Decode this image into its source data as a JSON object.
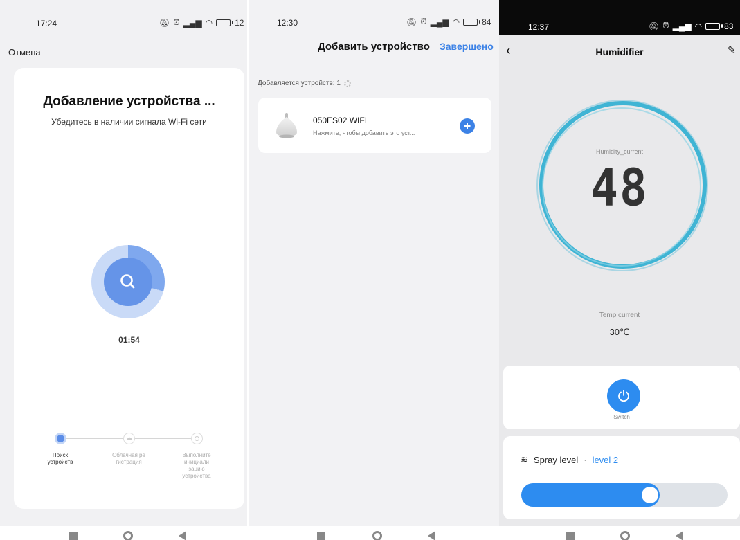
{
  "screen1": {
    "status": {
      "time": "17:24",
      "battery": "12"
    },
    "cancel_label": "Отмена",
    "title": "Добавление устройства ...",
    "subtitle": "Убедитесь в наличии сигнала Wi-Fi сети",
    "timer": "01:54",
    "steps": [
      {
        "label": "Поиск\nустройств",
        "state": "active"
      },
      {
        "label": "Облачная ре\nгистрация",
        "state": "pending"
      },
      {
        "label": "Выполните\nинициали\nзацию\nустройства",
        "state": "pending"
      }
    ]
  },
  "screen2": {
    "status": {
      "time": "12:30",
      "battery": "84"
    },
    "header_title": "Добавить устройство",
    "done_label": "Завершено",
    "adding_label": "Добавляется устройств: 1",
    "device": {
      "name": "050ES02 WIFI",
      "hint": "Нажмите, чтобы добавить это уст..."
    }
  },
  "screen3": {
    "status": {
      "time": "12:37",
      "battery": "83"
    },
    "title": "Humidifier",
    "humidity_label": "Humidity_current",
    "humidity_value": "48",
    "temp_label": "Temp current",
    "temp_value": "30℃",
    "switch_label": "Switch",
    "spray_label": "Spray level",
    "spray_separator": "·",
    "spray_value": "level 2",
    "spray_fraction": 0.67,
    "accent_color": "#2d8cf0"
  }
}
